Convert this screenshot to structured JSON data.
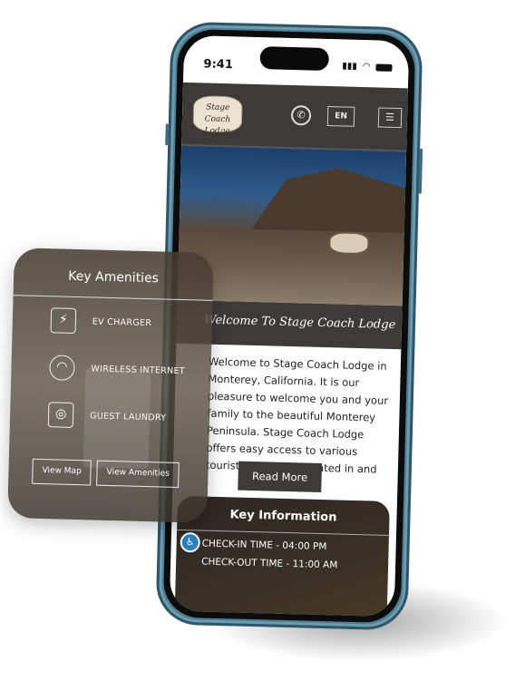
{
  "status_bar": {
    "time": "9:41"
  },
  "header": {
    "logo_text": "Stage Coach Lodge",
    "phone_icon": "phone-icon",
    "language": "EN",
    "menu_icon": "menu-icon"
  },
  "welcome": {
    "title": "Welcome To Stage Coach Lodge",
    "body": "Welcome to Stage Coach Lodge in Monterey, California. It is our pleasure to welcome you and your family to the beautiful Monterey Peninsula. Stage Coach Lodge offers easy access to various tourist attractions located in and",
    "read_more": "Read More"
  },
  "key_information": {
    "title": "Key Information",
    "rows": [
      "CHECK-IN TIME - 04:00 PM",
      "CHECK-OUT TIME - 11:00 AM"
    ],
    "accessibility_icon": "wheelchair-icon"
  },
  "amenities": {
    "title": "Key Amenities",
    "items": [
      {
        "label": "EV CHARGER",
        "icon": "ev-charger-icon"
      },
      {
        "label": "WIRELESS INTERNET",
        "icon": "wifi-icon"
      },
      {
        "label": "GUEST LAUNDRY",
        "icon": "laundry-icon"
      }
    ],
    "view_map": "View Map",
    "view_amenities": "View Amenities"
  },
  "colors": {
    "header": "#3d3b3a",
    "frame": "#4f7e93",
    "accessibility": "#2a7fc1"
  }
}
